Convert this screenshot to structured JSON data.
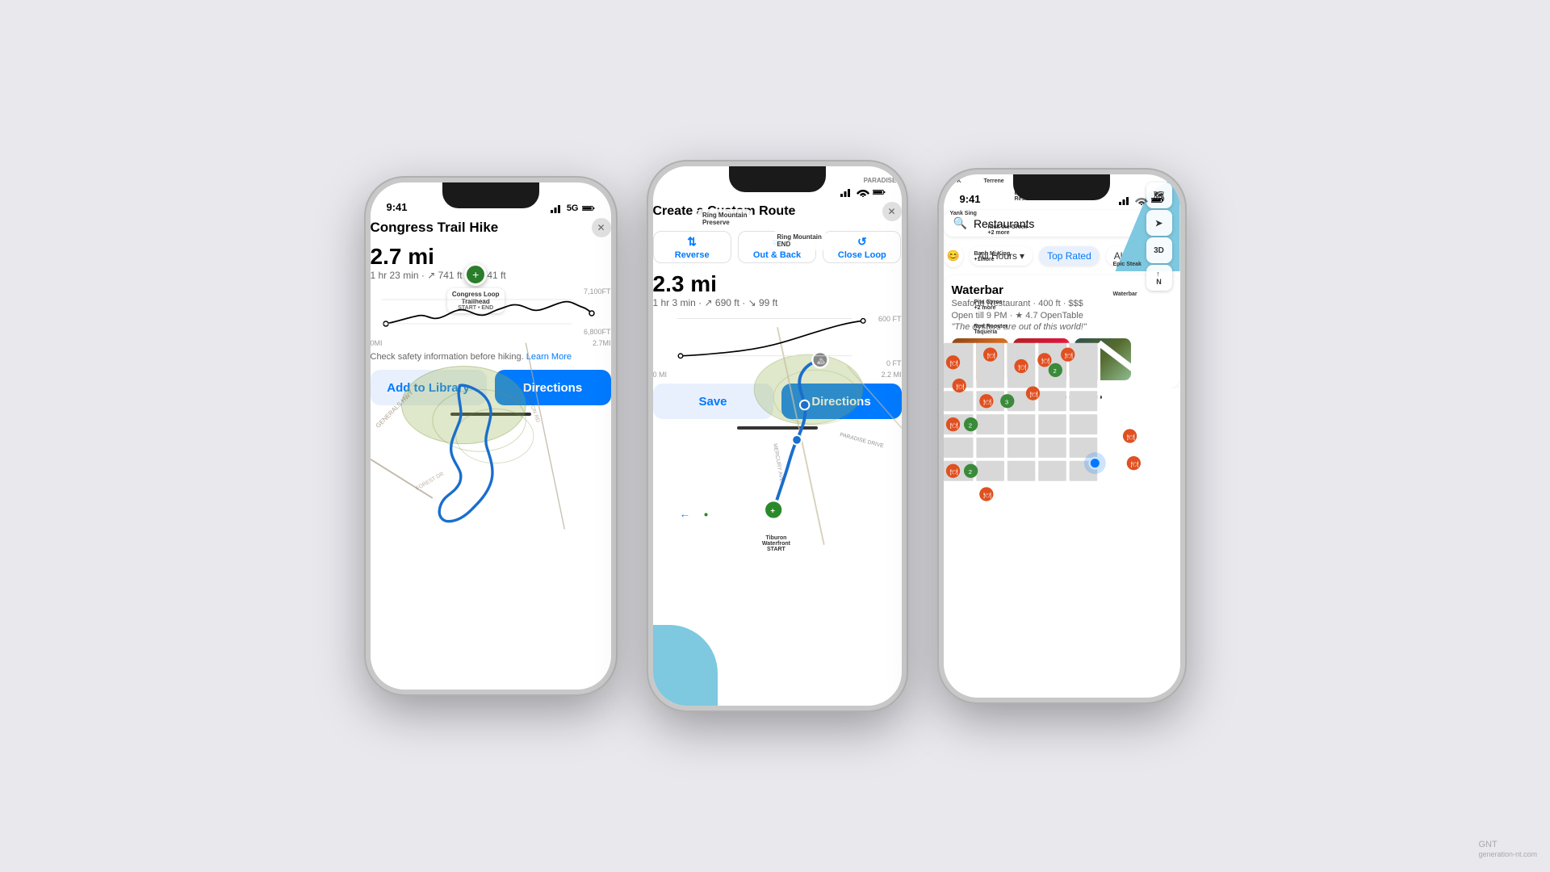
{
  "scene": {
    "background_color": "#e8e8ed"
  },
  "watermark": "GNT\ngeneration-nt.com",
  "phone1": {
    "status": {
      "time": "9:41",
      "signal": "5G",
      "battery": "full"
    },
    "map": {
      "trailhead_label": "Congress Loop\nTrailhead",
      "trailhead_sublabel": "START • END"
    },
    "panel": {
      "title": "Congress Trail Hike",
      "distance": "2.7 mi",
      "details": "1 hr 23 min · ↗ 741 ft · ↘ 741 ft",
      "elev_high": "7,100FT",
      "elev_low": "6,800FT",
      "dist_start": "0MI",
      "dist_end": "2.7MI",
      "safety_text": "Check safety information before hiking.",
      "safety_link": "Learn More",
      "btn_library": "Add to Library",
      "btn_directions": "Directions"
    }
  },
  "phone2": {
    "status": {
      "time": "9:41"
    },
    "map": {
      "start_label": "Tiburon\nWaterfront\nSTART",
      "end_label": "Ring Mountain\nEND",
      "paradise_label": "PARADISE",
      "preserve_label": "Ring Mountain\nPreserve"
    },
    "panel": {
      "title": "Create a Custom Route",
      "distance": "2.3 mi",
      "details": "1 hr 3 min · ↗ 690 ft · ↘ 99 ft",
      "elev_high": "600 FT",
      "elev_low": "0 FT",
      "dist_start": "0 MI",
      "dist_end": "2.2 MI",
      "btn_reverse": "Reverse",
      "btn_out_back": "Out & Back",
      "btn_close_loop": "Close Loop",
      "btn_save": "Save",
      "btn_directions": "Directions"
    }
  },
  "phone3": {
    "status": {
      "time": "9:41"
    },
    "map": {
      "controls": [
        "map-icon",
        "location-icon",
        "3D",
        "compass"
      ]
    },
    "panel": {
      "search_text": "Restaurants",
      "filter_hours": "All Hours",
      "filter_rated": "Top Rated",
      "filter_cuisine": "All Cuisines",
      "restaurant_name": "Waterbar",
      "restaurant_type": "Seafood Restaurant · 400 ft · $$$",
      "restaurant_hours": "Open till 9 PM · ★ 4.7 OpenTable",
      "restaurant_quote": "\"The oysters are out of this world!\""
    }
  }
}
